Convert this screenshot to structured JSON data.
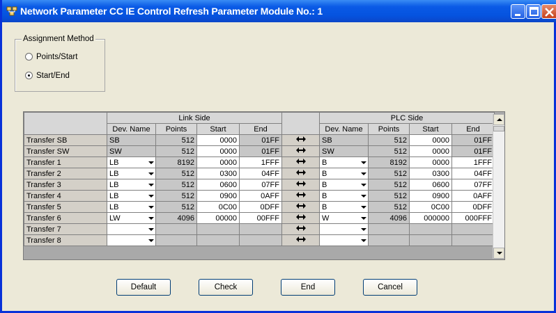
{
  "window": {
    "title": "Network Parameter  CC IE Control Refresh Parameter Module No.: 1",
    "accent": "#0a5ae6",
    "controls": [
      "minimize-icon",
      "maximize-icon",
      "close-icon"
    ]
  },
  "assignment": {
    "title": "Assignment Method",
    "options": [
      {
        "label": "Points/Start",
        "selected": false
      },
      {
        "label": "Start/End",
        "selected": true
      }
    ]
  },
  "table": {
    "link_side": "Link Side",
    "plc_side": "PLC Side",
    "columns": [
      "Dev. Name",
      "Points",
      "Start",
      "End"
    ],
    "rows": [
      {
        "label": "Transfer SB",
        "link": {
          "dev": "SB",
          "points": "512",
          "start": "0000",
          "end": "01FF"
        },
        "plc": {
          "dev": "SB",
          "points": "512",
          "start": "0000",
          "end": "01FF"
        }
      },
      {
        "label": "Transfer SW",
        "link": {
          "dev": "SW",
          "points": "512",
          "start": "0000",
          "end": "01FF"
        },
        "plc": {
          "dev": "SW",
          "points": "512",
          "start": "0000",
          "end": "01FF"
        }
      },
      {
        "label": "Transfer 1",
        "link": {
          "dev": "LB",
          "points": "8192",
          "start": "0000",
          "end": "1FFF"
        },
        "plc": {
          "dev": "B",
          "points": "8192",
          "start": "0000",
          "end": "1FFF"
        }
      },
      {
        "label": "Transfer 2",
        "link": {
          "dev": "LB",
          "points": "512",
          "start": "0300",
          "end": "04FF"
        },
        "plc": {
          "dev": "B",
          "points": "512",
          "start": "0300",
          "end": "04FF"
        }
      },
      {
        "label": "Transfer 3",
        "link": {
          "dev": "LB",
          "points": "512",
          "start": "0600",
          "end": "07FF"
        },
        "plc": {
          "dev": "B",
          "points": "512",
          "start": "0600",
          "end": "07FF"
        }
      },
      {
        "label": "Transfer 4",
        "link": {
          "dev": "LB",
          "points": "512",
          "start": "0900",
          "end": "0AFF"
        },
        "plc": {
          "dev": "B",
          "points": "512",
          "start": "0900",
          "end": "0AFF"
        }
      },
      {
        "label": "Transfer 5",
        "link": {
          "dev": "LB",
          "points": "512",
          "start": "0C00",
          "end": "0DFF"
        },
        "plc": {
          "dev": "B",
          "points": "512",
          "start": "0C00",
          "end": "0DFF"
        }
      },
      {
        "label": "Transfer 6",
        "link": {
          "dev": "LW",
          "points": "4096",
          "start": "00000",
          "end": "00FFF"
        },
        "plc": {
          "dev": "W",
          "points": "4096",
          "start": "000000",
          "end": "000FFF"
        }
      },
      {
        "label": "Transfer 7",
        "link": {
          "dev": "",
          "points": "",
          "start": "",
          "end": ""
        },
        "plc": {
          "dev": "",
          "points": "",
          "start": "",
          "end": ""
        }
      },
      {
        "label": "Transfer 8",
        "link": {
          "dev": "",
          "points": "",
          "start": "",
          "end": ""
        },
        "plc": {
          "dev": "",
          "points": "",
          "start": "",
          "end": ""
        }
      }
    ]
  },
  "buttons": {
    "default": "Default",
    "check": "Check",
    "end": "End",
    "cancel": "Cancel"
  }
}
